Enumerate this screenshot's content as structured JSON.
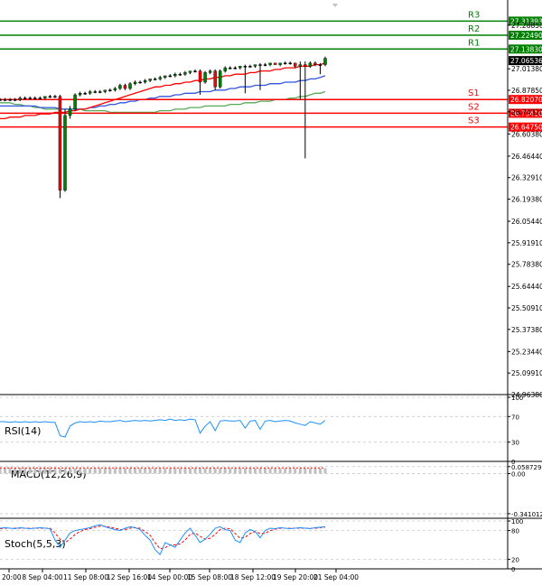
{
  "chart_data": {
    "type": "candlestick",
    "main": {
      "ylim": [
        24.9638,
        27.39
      ],
      "price_ticks": [
        "27.28850",
        "27.01380",
        "26.87850",
        "26.74320",
        "26.60380",
        "26.46440",
        "26.32910",
        "26.19380",
        "26.05440",
        "25.91910",
        "25.78380",
        "25.64440",
        "25.50910",
        "25.37380",
        "25.23440",
        "25.09910",
        "24.96380"
      ],
      "levels": [
        {
          "label": "R3",
          "value": 27.31393,
          "price_text": "27.31393",
          "color": "#008000"
        },
        {
          "label": "R2",
          "value": 27.2249,
          "price_text": "27.22490",
          "color": "#008000"
        },
        {
          "label": "R1",
          "value": 27.1383,
          "price_text": "27.13830",
          "color": "#008000"
        },
        {
          "label": "S1",
          "value": 26.8207,
          "price_text": "26.82070",
          "color": "#ff0000"
        },
        {
          "label": "S2",
          "value": 26.7341,
          "price_text": "26.73410",
          "color": "#ff0000"
        },
        {
          "label": "S3",
          "value": 26.6475,
          "price_text": "26.64750",
          "color": "#ff0000"
        }
      ],
      "current_price": {
        "value": 27.06536,
        "text": "27.06536"
      },
      "candles": [
        [
          26.82,
          26.83,
          26.81,
          26.82
        ],
        [
          26.82,
          26.83,
          26.81,
          26.82
        ],
        [
          26.82,
          26.83,
          26.81,
          26.82
        ],
        [
          26.82,
          26.83,
          26.81,
          26.82
        ],
        [
          26.82,
          26.84,
          26.81,
          26.83
        ],
        [
          26.83,
          26.84,
          26.82,
          26.83
        ],
        [
          26.83,
          26.84,
          26.82,
          26.83
        ],
        [
          26.83,
          26.84,
          26.82,
          26.83
        ],
        [
          26.83,
          26.84,
          26.82,
          26.83
        ],
        [
          26.83,
          26.84,
          26.82,
          26.84
        ],
        [
          26.84,
          26.85,
          26.83,
          26.84
        ],
        [
          26.84,
          26.85,
          26.83,
          26.84
        ],
        [
          26.84,
          26.85,
          26.2,
          26.25
        ],
        [
          26.25,
          26.76,
          26.24,
          26.72
        ],
        [
          26.72,
          26.78,
          26.7,
          26.76
        ],
        [
          26.76,
          26.86,
          26.75,
          26.85
        ],
        [
          26.85,
          26.87,
          26.84,
          26.86
        ],
        [
          26.86,
          26.87,
          26.85,
          26.86
        ],
        [
          26.86,
          26.88,
          26.85,
          26.87
        ],
        [
          26.87,
          26.88,
          26.86,
          26.87
        ],
        [
          26.87,
          26.88,
          26.86,
          26.87
        ],
        [
          26.87,
          26.88,
          26.86,
          26.88
        ],
        [
          26.88,
          26.89,
          26.87,
          26.88
        ],
        [
          26.88,
          26.9,
          26.87,
          26.89
        ],
        [
          26.89,
          26.92,
          26.88,
          26.91
        ],
        [
          26.91,
          26.92,
          26.88,
          26.89
        ],
        [
          26.89,
          26.93,
          26.88,
          26.92
        ],
        [
          26.92,
          26.94,
          26.91,
          26.93
        ],
        [
          26.93,
          26.94,
          26.92,
          26.93
        ],
        [
          26.93,
          26.95,
          26.92,
          26.94
        ],
        [
          26.94,
          26.95,
          26.93,
          26.95
        ],
        [
          26.95,
          26.96,
          26.94,
          26.95
        ],
        [
          26.95,
          26.97,
          26.94,
          26.96
        ],
        [
          26.96,
          26.97,
          26.95,
          26.97
        ],
        [
          26.97,
          26.98,
          26.96,
          26.97
        ],
        [
          26.97,
          26.99,
          26.96,
          26.98
        ],
        [
          26.98,
          26.99,
          26.97,
          26.98
        ],
        [
          26.98,
          27.0,
          26.97,
          26.99
        ],
        [
          26.99,
          27.0,
          26.98,
          27.0
        ],
        [
          27.0,
          27.01,
          26.99,
          27.0
        ],
        [
          27.0,
          27.01,
          26.85,
          26.93
        ],
        [
          26.93,
          27.0,
          26.92,
          26.99
        ],
        [
          26.99,
          27.01,
          26.98,
          27.0
        ],
        [
          27.0,
          27.01,
          26.88,
          26.9
        ],
        [
          26.9,
          27.01,
          26.89,
          27.0
        ],
        [
          27.0,
          27.03,
          26.99,
          27.02
        ],
        [
          27.02,
          27.03,
          27.01,
          27.02
        ],
        [
          27.02,
          27.03,
          27.01,
          27.02
        ],
        [
          27.02,
          27.03,
          27.01,
          27.03
        ],
        [
          27.03,
          27.04,
          26.86,
          27.03
        ],
        [
          27.03,
          27.04,
          27.02,
          27.03
        ],
        [
          27.03,
          27.04,
          27.02,
          27.04
        ],
        [
          27.04,
          27.05,
          26.88,
          27.04
        ],
        [
          27.04,
          27.05,
          27.03,
          27.04
        ],
        [
          27.04,
          27.05,
          27.03,
          27.05
        ],
        [
          27.05,
          27.05,
          27.04,
          27.04
        ],
        [
          27.04,
          27.05,
          27.03,
          27.05
        ],
        [
          27.05,
          27.06,
          27.04,
          27.05
        ],
        [
          27.05,
          27.06,
          27.04,
          27.05
        ],
        [
          27.05,
          27.05,
          27.02,
          27.03
        ],
        [
          27.03,
          27.06,
          26.82,
          27.04
        ],
        [
          27.04,
          27.06,
          26.45,
          27.03
        ],
        [
          27.03,
          27.06,
          27.02,
          27.05
        ],
        [
          27.05,
          27.06,
          27.03,
          27.04
        ],
        [
          27.04,
          27.05,
          26.98,
          27.04
        ],
        [
          27.04,
          27.09,
          27.03,
          27.08
        ]
      ],
      "ma_red": [
        26.7,
        26.7,
        26.71,
        26.71,
        26.71,
        26.72,
        26.72,
        26.72,
        26.73,
        26.73,
        26.73,
        26.74,
        26.74,
        26.74,
        26.75,
        26.75,
        26.76,
        26.76,
        26.77,
        26.78,
        26.79,
        26.8,
        26.81,
        26.82,
        26.83,
        26.84,
        26.85,
        26.86,
        26.87,
        26.88,
        26.89,
        26.9,
        26.9,
        26.91,
        26.91,
        26.92,
        26.92,
        26.93,
        26.93,
        26.94,
        26.94,
        26.95,
        26.95,
        26.96,
        26.96,
        26.97,
        26.97,
        26.98,
        26.98,
        26.98,
        26.99,
        26.99,
        27.0,
        27.0,
        27.0,
        27.01,
        27.01,
        27.02,
        27.02,
        27.02,
        27.03,
        27.03,
        27.03,
        27.04,
        27.04,
        27.05
      ],
      "ma_blue": [
        26.78,
        26.78,
        26.78,
        26.78,
        26.78,
        26.78,
        26.78,
        26.78,
        26.77,
        26.77,
        26.77,
        26.77,
        26.76,
        26.76,
        26.76,
        26.76,
        26.76,
        26.76,
        26.77,
        26.77,
        26.78,
        26.78,
        26.79,
        26.79,
        26.8,
        26.8,
        26.81,
        26.81,
        26.82,
        26.82,
        26.83,
        26.83,
        26.84,
        26.84,
        26.84,
        26.85,
        26.85,
        26.86,
        26.86,
        26.86,
        26.87,
        26.87,
        26.87,
        26.88,
        26.88,
        26.88,
        26.89,
        26.89,
        26.9,
        26.9,
        26.9,
        26.91,
        26.91,
        26.91,
        26.92,
        26.92,
        26.92,
        26.93,
        26.93,
        26.93,
        26.94,
        26.94,
        26.95,
        26.95,
        26.96,
        26.97
      ],
      "ma_green": [
        26.8,
        26.8,
        26.8,
        26.79,
        26.79,
        26.78,
        26.78,
        26.77,
        26.77,
        26.76,
        26.76,
        26.76,
        26.76,
        26.76,
        26.76,
        26.76,
        26.76,
        26.75,
        26.75,
        26.75,
        26.75,
        26.75,
        26.74,
        26.74,
        26.74,
        26.74,
        26.74,
        26.74,
        26.74,
        26.74,
        26.74,
        26.74,
        26.75,
        26.75,
        26.75,
        26.76,
        26.76,
        26.76,
        26.77,
        26.77,
        26.77,
        26.78,
        26.78,
        26.78,
        26.78,
        26.78,
        26.79,
        26.79,
        26.79,
        26.8,
        26.8,
        26.8,
        26.81,
        26.81,
        26.81,
        26.82,
        26.82,
        26.82,
        26.83,
        26.83,
        26.84,
        26.84,
        26.85,
        26.86,
        26.86,
        26.87
      ]
    },
    "rsi": {
      "label": "RSI(14)",
      "ticks": [
        "100",
        "70",
        "30",
        "0"
      ],
      "ylim": [
        0,
        100
      ],
      "values": [
        62,
        62,
        61,
        62,
        61,
        62,
        61,
        62,
        61,
        62,
        61,
        61,
        40,
        38,
        55,
        60,
        62,
        61,
        62,
        61,
        63,
        62,
        62,
        63,
        64,
        62,
        63,
        64,
        63,
        64,
        63,
        64,
        65,
        64,
        66,
        64,
        65,
        64,
        66,
        65,
        44,
        55,
        62,
        48,
        63,
        64,
        63,
        63,
        64,
        52,
        63,
        64,
        50,
        63,
        64,
        62,
        63,
        64,
        63,
        60,
        58,
        56,
        62,
        60,
        58,
        64
      ]
    },
    "macd": {
      "label": "MACD(12,26,9)",
      "ticks": [
        "0.058729",
        "0.00",
        "-0.341012"
      ],
      "ylim": [
        -0.38,
        0.08
      ],
      "values": [
        0.05,
        0.05,
        0.05,
        0.05,
        0.05,
        0.05,
        0.05,
        0.05,
        0.05,
        0.05,
        0.05,
        0.05,
        0.045,
        0.045,
        0.045,
        0.045,
        0.045,
        0.045,
        0.045,
        0.045,
        0.045,
        0.045,
        0.045,
        0.045,
        0.045,
        0.045,
        0.045,
        0.045,
        0.045,
        0.045,
        0.045,
        0.045,
        0.045,
        0.045,
        0.045,
        0.045,
        0.045,
        0.045,
        0.045,
        0.045,
        0.045,
        0.045,
        0.045,
        0.045,
        0.045,
        0.045,
        0.045,
        0.045,
        0.045,
        0.045,
        0.045,
        0.045,
        0.045,
        0.045,
        0.045,
        0.045,
        0.045,
        0.045,
        0.045,
        0.045,
        0.045,
        0.045,
        0.045,
        0.045,
        0.045,
        0.045
      ],
      "signal": [
        0.048,
        0.048,
        0.048,
        0.048,
        0.048,
        0.048,
        0.048,
        0.048,
        0.048,
        0.048,
        0.048,
        0.048,
        0.047,
        0.047,
        0.047,
        0.047,
        0.047,
        0.047,
        0.047,
        0.047,
        0.047,
        0.047,
        0.047,
        0.047,
        0.047,
        0.047,
        0.047,
        0.047,
        0.047,
        0.047,
        0.047,
        0.047,
        0.047,
        0.047,
        0.047,
        0.047,
        0.047,
        0.047,
        0.047,
        0.047,
        0.047,
        0.047,
        0.047,
        0.047,
        0.047,
        0.047,
        0.047,
        0.047,
        0.047,
        0.047,
        0.047,
        0.047,
        0.047,
        0.047,
        0.047,
        0.047,
        0.047,
        0.047,
        0.047,
        0.047,
        0.047,
        0.047,
        0.047,
        0.047,
        0.047,
        0.047
      ]
    },
    "stoch": {
      "label": "Stoch(5,5,3)",
      "ticks": [
        "100",
        "80",
        "20",
        "0"
      ],
      "ylim": [
        0,
        100
      ],
      "main": [
        85,
        86,
        85,
        84,
        86,
        85,
        84,
        85,
        86,
        85,
        84,
        60,
        45,
        60,
        75,
        80,
        82,
        84,
        86,
        90,
        92,
        88,
        85,
        82,
        80,
        85,
        88,
        86,
        82,
        70,
        60,
        40,
        30,
        55,
        50,
        45,
        60,
        75,
        85,
        70,
        55,
        62,
        72,
        85,
        88,
        82,
        80,
        60,
        55,
        75,
        82,
        78,
        65,
        80,
        85,
        84,
        86,
        85,
        84,
        85,
        86,
        85,
        84,
        86,
        87,
        88
      ],
      "signal": [
        84,
        85,
        85,
        85,
        85,
        85,
        85,
        85,
        85,
        85,
        85,
        75,
        62,
        55,
        62,
        72,
        78,
        82,
        84,
        87,
        89,
        89,
        87,
        85,
        82,
        82,
        85,
        86,
        85,
        78,
        70,
        55,
        42,
        44,
        50,
        50,
        52,
        60,
        72,
        75,
        68,
        62,
        64,
        72,
        82,
        85,
        84,
        74,
        64,
        66,
        74,
        78,
        74,
        74,
        80,
        83,
        85,
        85,
        85,
        85,
        85,
        85,
        85,
        85,
        86,
        87
      ]
    },
    "x_tick_labels": [
      "20:00",
      "8 Sep 04:00",
      "11 Sep 08:00",
      "12 Sep 16:00",
      "14 Sep 00:00",
      "15 Sep 08:00",
      "18 Sep 12:00",
      "19 Sep 20:00",
      "21 Sep 04:00"
    ],
    "colors": {
      "bull": "#008000",
      "bear": "#ff0000",
      "ma_red": "#ff0000",
      "ma_blue": "#3355dd",
      "ma_green": "#55aa55",
      "rsi_line": "#1e90ff",
      "stoch_main": "#1e90ff",
      "stoch_signal": "#ff0000",
      "macd": "#c0c0c0",
      "macd_signal": "#ff0000",
      "current_price_bg": "#000000",
      "grid": "#c8c8c8"
    }
  }
}
